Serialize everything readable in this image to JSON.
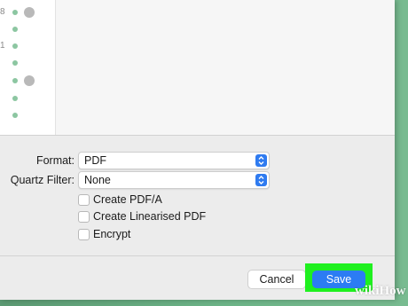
{
  "file_list": {
    "rows": [
      {
        "fragment": "8",
        "cloud": true
      },
      {
        "fragment": "",
        "cloud": false
      },
      {
        "fragment": "1",
        "cloud": false
      },
      {
        "fragment": "",
        "cloud": false
      },
      {
        "fragment": "",
        "cloud": true
      },
      {
        "fragment": "",
        "cloud": false
      },
      {
        "fragment": "",
        "cloud": false
      }
    ]
  },
  "options": {
    "format_label": "Format:",
    "format_value": "PDF",
    "quartz_filter_label": "Quartz Filter:",
    "quartz_filter_value": "None",
    "create_pdfa_label": "Create PDF/A",
    "create_linearised_label": "Create Linearised PDF",
    "encrypt_label": "Encrypt",
    "create_pdfa_checked": false,
    "create_linearised_checked": false,
    "encrypt_checked": false
  },
  "buttons": {
    "cancel_label": "Cancel",
    "save_label": "Save"
  },
  "watermark": "wikiHow",
  "colors": {
    "accent": "#2c7cf3",
    "highlight": "#1ff01f",
    "background": "#6db588",
    "tag": "#8cc6a1"
  }
}
